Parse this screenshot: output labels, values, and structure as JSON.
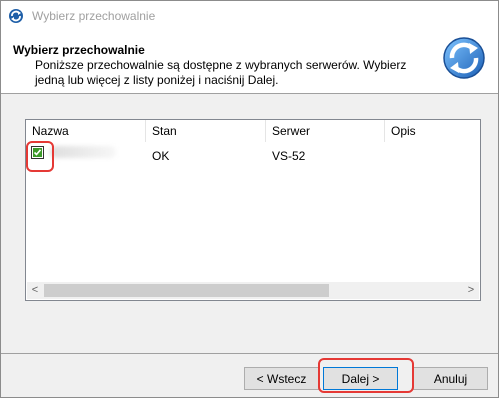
{
  "window": {
    "title": "Wybierz przechowalnie",
    "icon": "refresh-sync-icon"
  },
  "header": {
    "title": "Wybierz przechowalnie",
    "description": "Poniższe przechowalnie są dostępne z wybranych serwerów. Wybierz jedną lub więcej z listy poniżej i naciśnij Dalej.",
    "icon": "refresh-sync-icon"
  },
  "list": {
    "columns": [
      "Nazwa",
      "Stan",
      "Serwer",
      "Opis"
    ],
    "rows": [
      {
        "checked": true,
        "name": "",
        "status": "OK",
        "server": "VS-52",
        "description": ""
      }
    ]
  },
  "buttons": {
    "back": "< Wstecz",
    "next": "Dalej >",
    "cancel": "Anuluj"
  },
  "colors": {
    "highlight": "#e53935",
    "check": "#3c9a2a"
  }
}
